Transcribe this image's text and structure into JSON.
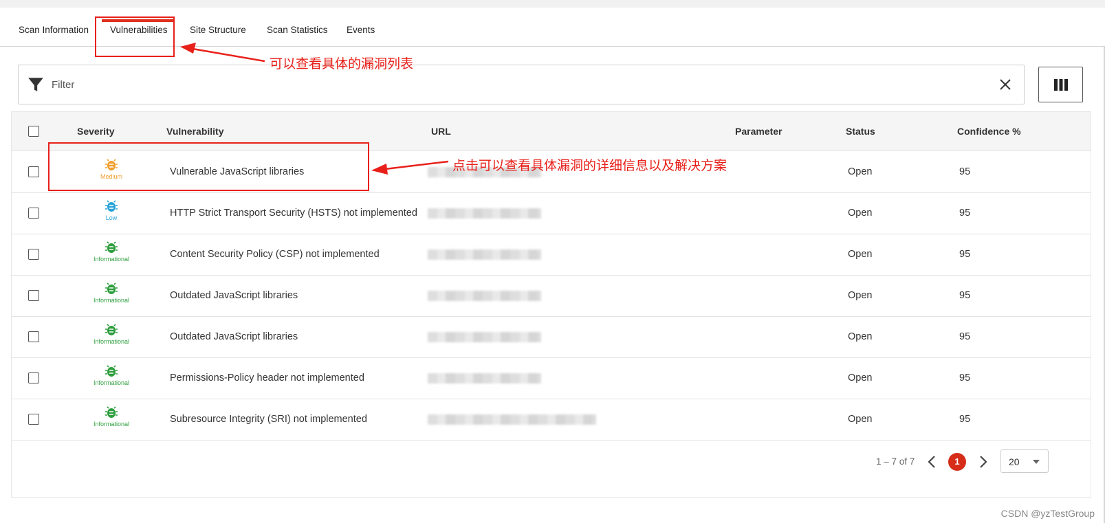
{
  "tabs": [
    {
      "label": "Scan Information"
    },
    {
      "label": "Vulnerabilities",
      "active": true
    },
    {
      "label": "Site Structure"
    },
    {
      "label": "Scan Statistics"
    },
    {
      "label": "Events"
    }
  ],
  "filter": {
    "placeholder": "Filter"
  },
  "table": {
    "columns": {
      "severity": "Severity",
      "vulnerability": "Vulnerability",
      "url": "URL",
      "parameter": "Parameter",
      "status": "Status",
      "confidence": "Confidence %"
    },
    "rows": [
      {
        "severity": "Medium",
        "vulnerability": "Vulnerable JavaScript libraries",
        "status": "Open",
        "confidence": "95"
      },
      {
        "severity": "Low",
        "vulnerability": "HTTP Strict Transport Security (HSTS) not implemented",
        "status": "Open",
        "confidence": "95"
      },
      {
        "severity": "Informational",
        "vulnerability": "Content Security Policy (CSP) not implemented",
        "status": "Open",
        "confidence": "95"
      },
      {
        "severity": "Informational",
        "vulnerability": "Outdated JavaScript libraries",
        "status": "Open",
        "confidence": "95"
      },
      {
        "severity": "Informational",
        "vulnerability": "Outdated JavaScript libraries",
        "status": "Open",
        "confidence": "95"
      },
      {
        "severity": "Informational",
        "vulnerability": "Permissions-Policy header not implemented",
        "status": "Open",
        "confidence": "95"
      },
      {
        "severity": "Informational",
        "vulnerability": "Subresource Integrity (SRI) not implemented",
        "status": "Open",
        "confidence": "95"
      }
    ]
  },
  "severity_colors": {
    "Medium": "#f0a030",
    "Low": "#2aa4d8",
    "Informational": "#2e9e3e"
  },
  "pagination": {
    "range": "1 – 7 of 7",
    "current_page": "1",
    "page_size": "20"
  },
  "annotations": {
    "tab_note": "可以查看具体的漏洞列表",
    "row_note": "点击可以查看具体漏洞的详细信息以及解决方案"
  },
  "accent_color": "#d62c18",
  "watermark": "CSDN @yzTestGroup"
}
